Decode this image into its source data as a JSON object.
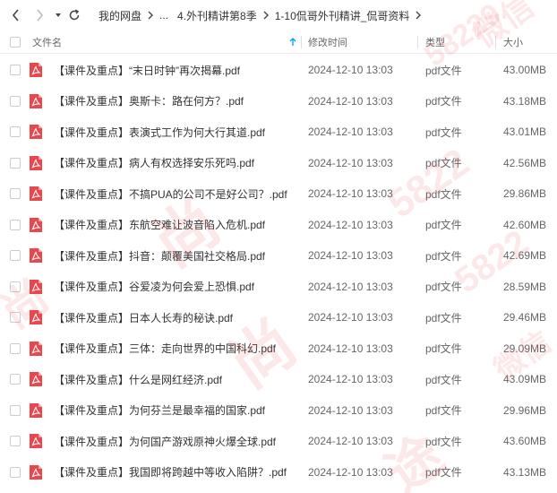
{
  "nav": {
    "breadcrumbs": [
      "我的网盘",
      "...",
      "4.外刊精讲第8季",
      "1-10侃哥外刊精讲_侃哥资料"
    ]
  },
  "columns": {
    "name": "文件名",
    "modified": "修改时间",
    "type": "类型",
    "size": "大小"
  },
  "files": [
    {
      "name": "【课件及重点】“末日时钟”再次揭幕.pdf",
      "modified": "2024-12-10 13:03",
      "type": "pdf文件",
      "size": "43.00MB"
    },
    {
      "name": "【课件及重点】奥斯卡：路在何方？.pdf",
      "modified": "2024-12-10 13:03",
      "type": "pdf文件",
      "size": "43.18MB"
    },
    {
      "name": "【课件及重点】表演式工作为何大行其道.pdf",
      "modified": "2024-12-10 13:03",
      "type": "pdf文件",
      "size": "43.01MB"
    },
    {
      "name": "【课件及重点】病人有权选择安乐死吗.pdf",
      "modified": "2024-12-10 13:03",
      "type": "pdf文件",
      "size": "42.56MB"
    },
    {
      "name": "【课件及重点】不搞PUA的公司不是好公司？.pdf",
      "modified": "2024-12-10 13:03",
      "type": "pdf文件",
      "size": "29.86MB"
    },
    {
      "name": "【课件及重点】东航空难让波音陷入危机.pdf",
      "modified": "2024-12-10 13:03",
      "type": "pdf文件",
      "size": "42.60MB"
    },
    {
      "name": "【课件及重点】抖音：颠覆美国社交格局.pdf",
      "modified": "2024-12-10 13:03",
      "type": "pdf文件",
      "size": "42.69MB"
    },
    {
      "name": "【课件及重点】谷爱凌为何会爱上恐惧.pdf",
      "modified": "2024-12-10 13:03",
      "type": "pdf文件",
      "size": "28.59MB"
    },
    {
      "name": "【课件及重点】日本人长寿的秘诀.pdf",
      "modified": "2024-12-10 13:03",
      "type": "pdf文件",
      "size": "29.46MB"
    },
    {
      "name": "【课件及重点】三体：走向世界的中国科幻.pdf",
      "modified": "2024-12-10 13:03",
      "type": "pdf文件",
      "size": "29.09MB"
    },
    {
      "name": "【课件及重点】什么是网红经济.pdf",
      "modified": "2024-12-10 13:03",
      "type": "pdf文件",
      "size": "43.09MB"
    },
    {
      "name": "【课件及重点】为何芬兰是最幸福的国家.pdf",
      "modified": "2024-12-10 13:03",
      "type": "pdf文件",
      "size": "29.96MB"
    },
    {
      "name": "【课件及重点】为何国产游戏原神火爆全球.pdf",
      "modified": "2024-12-10 13:03",
      "type": "pdf文件",
      "size": "43.60MB"
    },
    {
      "name": "【课件及重点】我国即将跨越中等收入陷阱？.pdf",
      "modified": "2024-12-10 13:03",
      "type": "pdf文件",
      "size": "43.13MB"
    }
  ],
  "colors": {
    "pdf_red": "#e8484d",
    "accent": "#06a7ff"
  },
  "watermarks": [
    "微信",
    "58229",
    "尚",
    "途",
    "5822"
  ]
}
